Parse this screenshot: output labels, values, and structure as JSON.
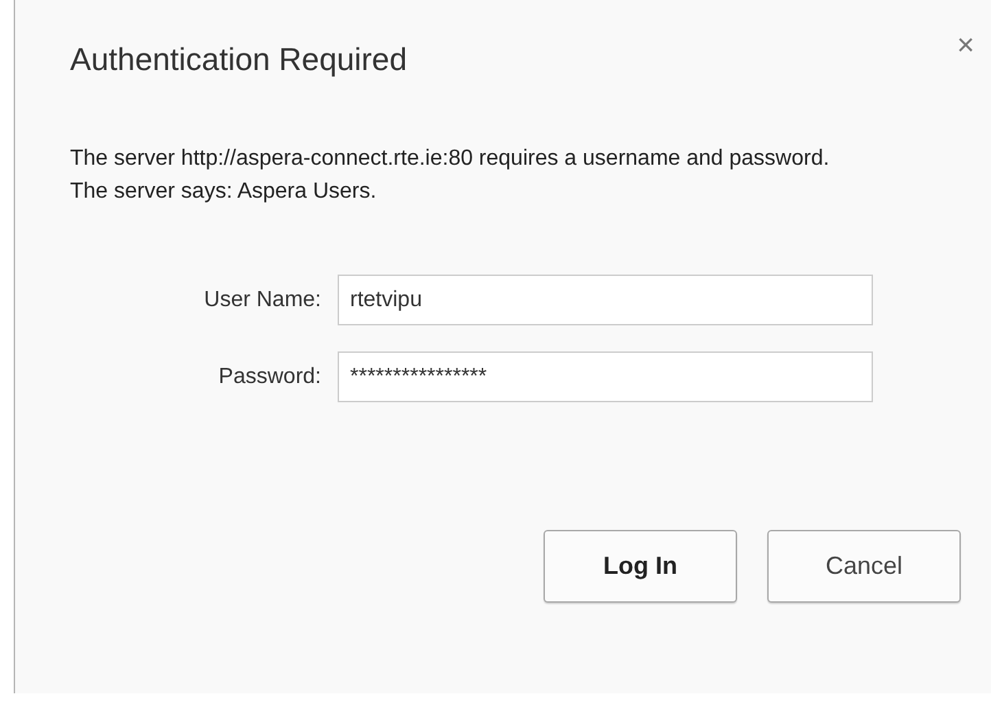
{
  "dialog": {
    "title": "Authentication Required",
    "close": "×",
    "message": "The server http://aspera-connect.rte.ie:80 requires a username and password. The server says: Aspera Users.",
    "fields": [
      {
        "label": "User Name:",
        "value": "rtetvipu"
      },
      {
        "label": "Password:",
        "value": "****************"
      }
    ],
    "buttons": [
      {
        "label": "Log In",
        "default": true
      },
      {
        "label": "Cancel",
        "default": false
      }
    ]
  }
}
